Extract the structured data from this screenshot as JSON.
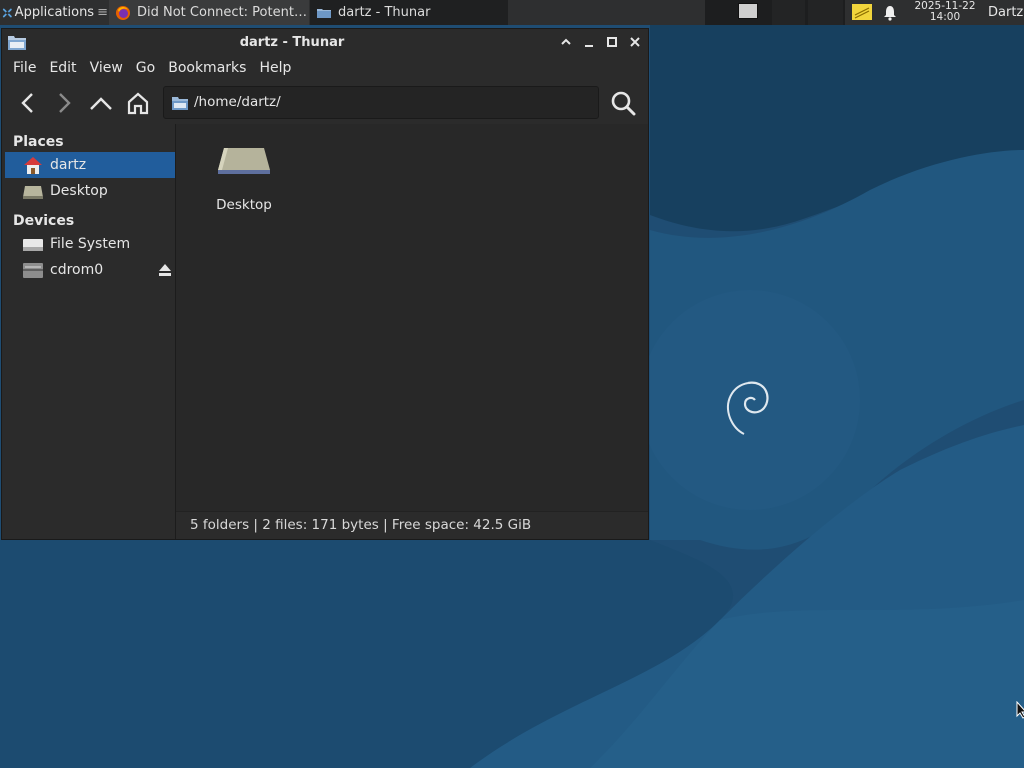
{
  "panel": {
    "applications_label": "Applications",
    "applications_sep": "≡",
    "tasks": [
      {
        "label": "Did Not Connect: Potent…"
      },
      {
        "label": "dartz - Thunar"
      }
    ],
    "clock": {
      "date": "2025-11-22",
      "time": "14:00"
    },
    "user": "Dartz"
  },
  "window": {
    "title": "dartz - Thunar",
    "menu": [
      "File",
      "Edit",
      "View",
      "Go",
      "Bookmarks",
      "Help"
    ],
    "location": "/home/dartz/",
    "sidebar": {
      "places_heading": "Places",
      "places": [
        {
          "label": "dartz",
          "icon": "home-icon",
          "selected": true
        },
        {
          "label": "Desktop",
          "icon": "desktop-drive-icon",
          "selected": false
        }
      ],
      "devices_heading": "Devices",
      "devices": [
        {
          "label": "File System",
          "icon": "filesystem-drive-icon"
        },
        {
          "label": "cdrom0",
          "icon": "cdrom-drive-icon",
          "ejectable": true
        }
      ]
    },
    "files": [
      {
        "label": "Desktop",
        "icon": "desktop-folder-icon"
      }
    ],
    "status": "5 folders  |  2 files: 171 bytes  |  Free space: 42.5 GiB"
  },
  "colors": {
    "panel_bg": "#2e2f30",
    "window_bg": "#2b2b2b",
    "selection": "#215d9c",
    "wallpaper": "#1d4f75"
  }
}
